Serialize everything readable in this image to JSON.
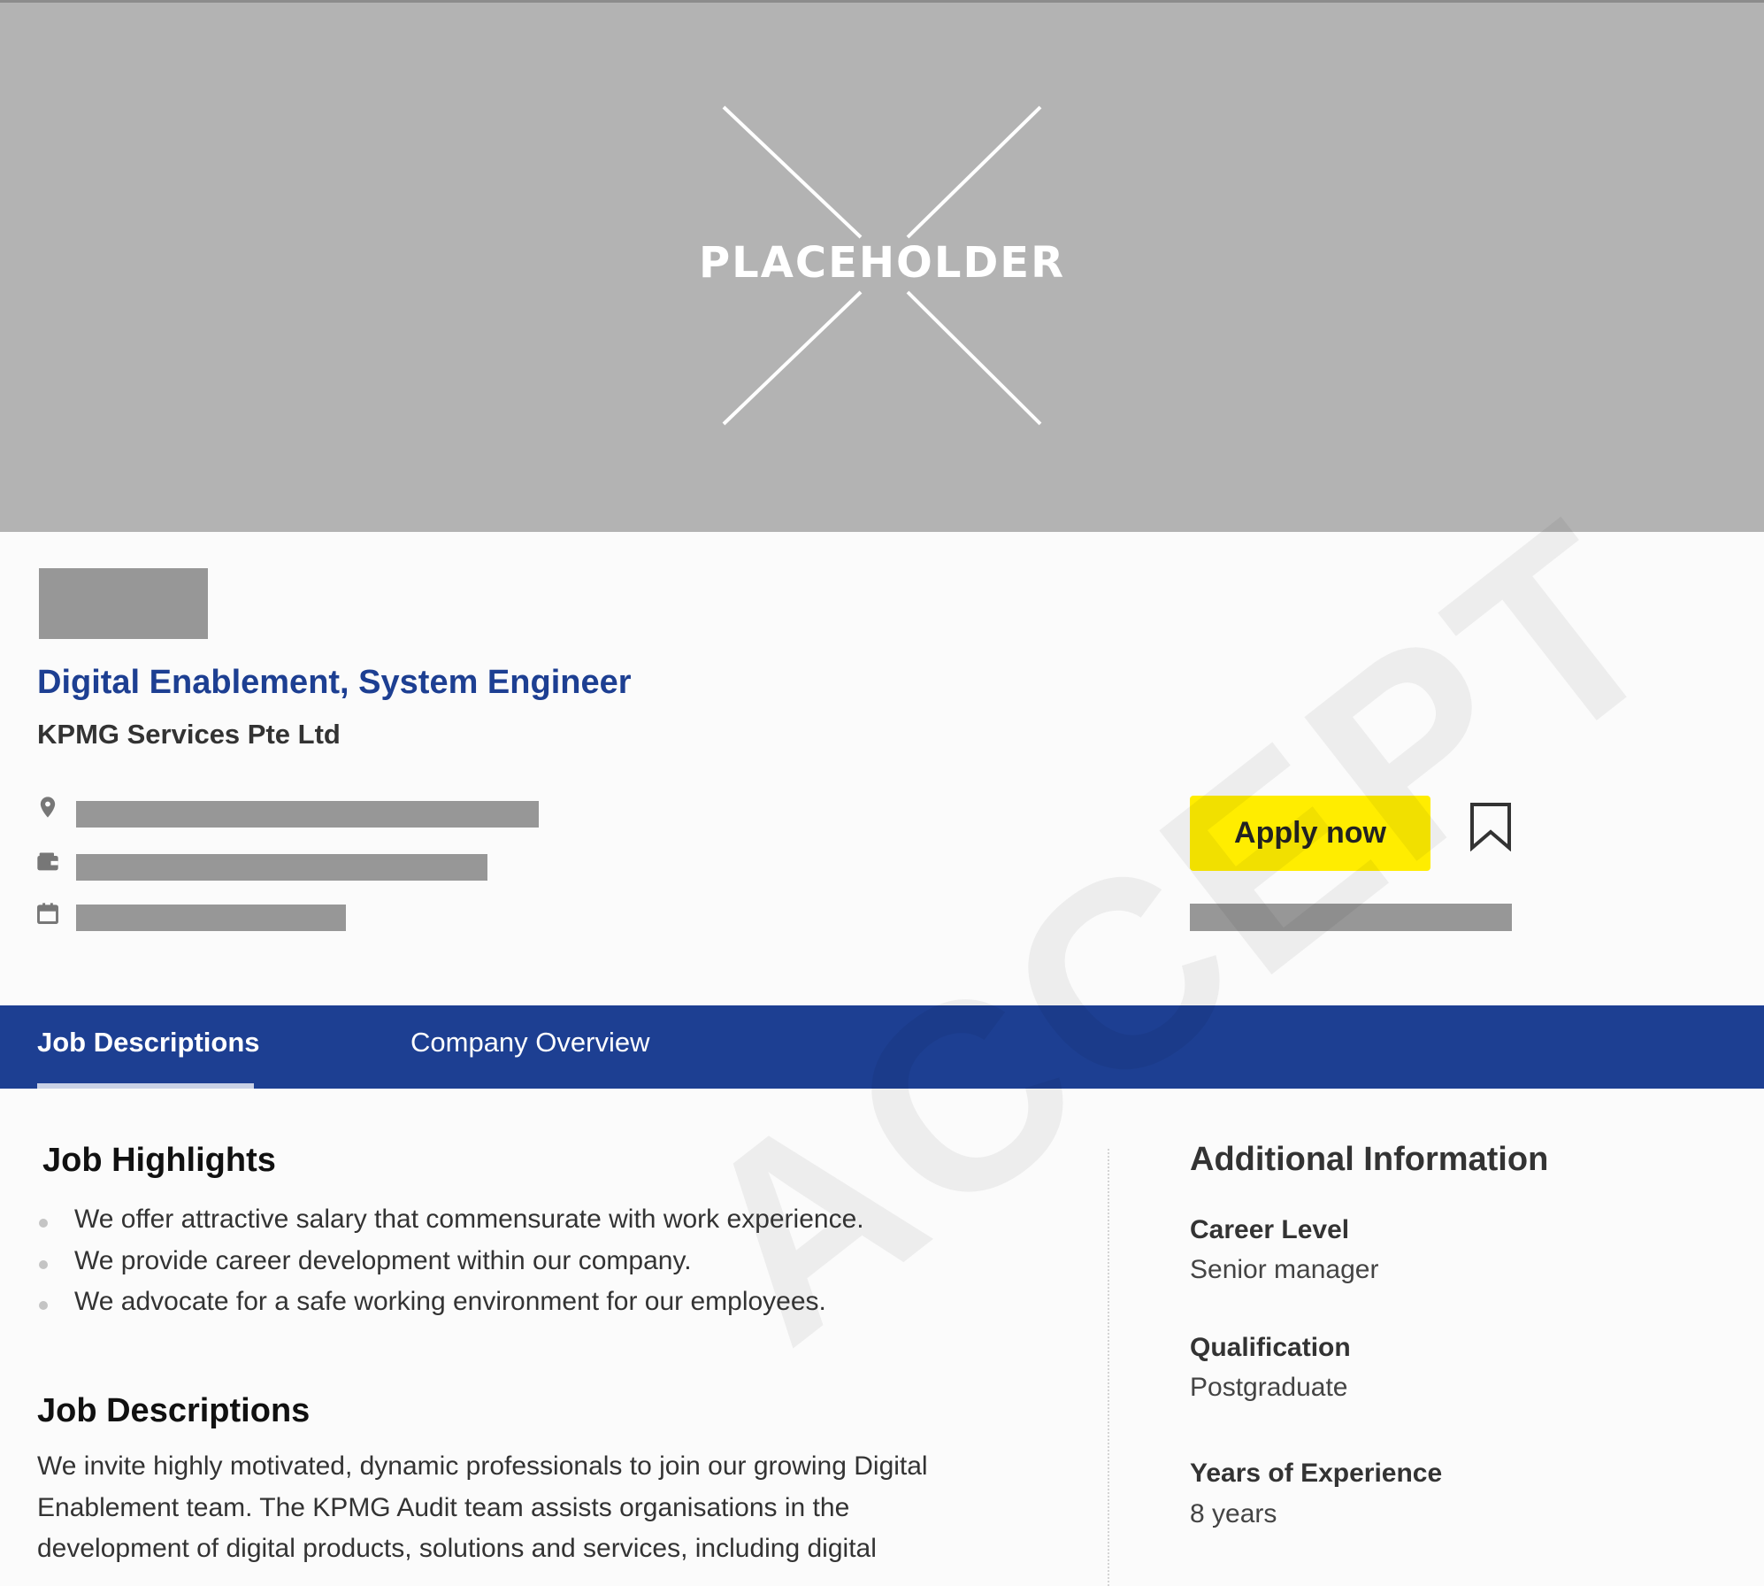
{
  "banner": {
    "placeholder_text": "PLACEHOLDER"
  },
  "job": {
    "title": "Digital Enablement, System Engineer",
    "company": "KPMG Services Pte Ltd",
    "meta_icons": [
      "location-pin-icon",
      "wallet-icon",
      "calendar-icon"
    ]
  },
  "actions": {
    "apply_label": "Apply now",
    "bookmark_icon": "bookmark-icon"
  },
  "tabs": [
    {
      "label": "Job Descriptions",
      "active": true
    },
    {
      "label": "Company Overview",
      "active": false
    }
  ],
  "watermark": "ACCEPT",
  "highlights": {
    "title": "Job Highlights",
    "items": [
      "We offer attractive salary that commensurate with work experience.",
      "We provide career development within our company.",
      "We advocate for a safe working environment for our employees."
    ]
  },
  "descriptions": {
    "title": "Job Descriptions",
    "lines": [
      "We invite highly motivated, dynamic professionals to join our growing Digital",
      "Enablement team. The KPMG Audit team assists organisations in the",
      "development of digital products, solutions and services, including digital"
    ]
  },
  "additional": {
    "title": "Additional Information",
    "fields": [
      {
        "label": "Career Level",
        "value": "Senior manager"
      },
      {
        "label": "Qualification",
        "value": "Postgraduate"
      },
      {
        "label": "Years of Experience",
        "value": "8 years"
      }
    ]
  },
  "colors": {
    "brand_blue": "#1d3f92",
    "apply_yellow": "#ffed00",
    "placeholder_gray": "#979797"
  }
}
